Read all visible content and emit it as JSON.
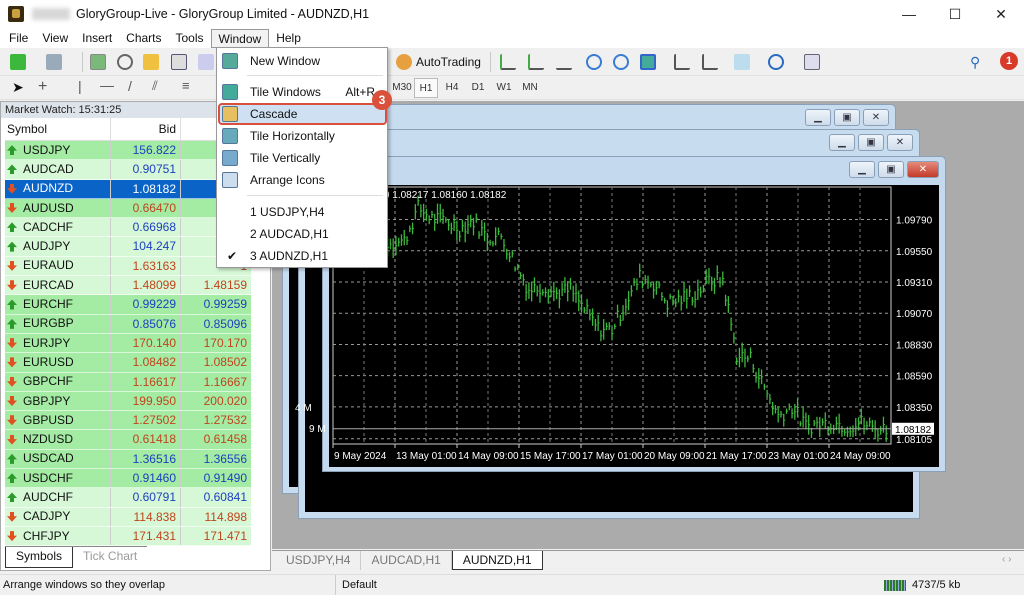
{
  "window": {
    "title": "GloryGroup-Live - GloryGroup Limited - AUDNZD,H1",
    "minimize": "—",
    "maximize": "☐",
    "close": "✕"
  },
  "menubar": [
    "File",
    "View",
    "Insert",
    "Charts",
    "Tools",
    "Window",
    "Help"
  ],
  "toolbar": {
    "autotrading": "AutoTrading",
    "timeframes": [
      "M30",
      "H1",
      "H4",
      "D1",
      "W1",
      "MN"
    ],
    "active_timeframe": "H1",
    "notification_count": "1"
  },
  "window_menu": {
    "items": [
      {
        "label": "New Window",
        "icon": "new-window-icon"
      },
      {
        "label": "Tile Windows",
        "shortcut": "Alt+R",
        "icon": "tile-windows-icon"
      },
      {
        "label": "Cascade",
        "icon": "cascade-icon",
        "highlighted": true
      },
      {
        "label": "Tile Horizontally",
        "icon": "tile-horizontally-icon"
      },
      {
        "label": "Tile Vertically",
        "icon": "tile-vertically-icon"
      },
      {
        "label": "Arrange Icons",
        "icon": "arrange-icons-icon"
      }
    ],
    "windows": [
      {
        "label": "1 USDJPY,H4"
      },
      {
        "label": "2 AUDCAD,H1"
      },
      {
        "label": "3 AUDNZD,H1",
        "checked": true
      }
    ],
    "check": "✔",
    "step_badge": "3"
  },
  "market_watch": {
    "title": "Market Watch: 15:31:25",
    "columns": [
      "Symbol",
      "Bid"
    ],
    "rows": [
      {
        "symbol": "USDJPY",
        "bid": "156.822",
        "ask": "1",
        "dir": "up",
        "shade": "g1"
      },
      {
        "symbol": "AUDCAD",
        "bid": "0.90751",
        "ask": "0",
        "dir": "up",
        "shade": "g0"
      },
      {
        "symbol": "AUDNZD",
        "bid": "1.08182",
        "ask": "1",
        "dir": "down",
        "shade": "sel"
      },
      {
        "symbol": "AUDUSD",
        "bid": "0.66470",
        "ask": "0",
        "dir": "down",
        "shade": "g1"
      },
      {
        "symbol": "CADCHF",
        "bid": "0.66968",
        "ask": "0",
        "dir": "up",
        "shade": "g0"
      },
      {
        "symbol": "AUDJPY",
        "bid": "104.247",
        "ask": "1",
        "dir": "up",
        "shade": "g0"
      },
      {
        "symbol": "EURAUD",
        "bid": "1.63163",
        "ask": "1",
        "dir": "down",
        "shade": "g0"
      },
      {
        "symbol": "EURCAD",
        "bid": "1.48099",
        "ask": "1.48159",
        "dir": "down",
        "shade": "g0"
      },
      {
        "symbol": "EURCHF",
        "bid": "0.99229",
        "ask": "0.99259",
        "dir": "up",
        "shade": "g1"
      },
      {
        "symbol": "EURGBP",
        "bid": "0.85076",
        "ask": "0.85096",
        "dir": "up",
        "shade": "g1"
      },
      {
        "symbol": "EURJPY",
        "bid": "170.140",
        "ask": "170.170",
        "dir": "down",
        "shade": "g1"
      },
      {
        "symbol": "EURUSD",
        "bid": "1.08482",
        "ask": "1.08502",
        "dir": "down",
        "shade": "g1"
      },
      {
        "symbol": "GBPCHF",
        "bid": "1.16617",
        "ask": "1.16667",
        "dir": "down",
        "shade": "g1"
      },
      {
        "symbol": "GBPJPY",
        "bid": "199.950",
        "ask": "200.020",
        "dir": "down",
        "shade": "g1"
      },
      {
        "symbol": "GBPUSD",
        "bid": "1.27502",
        "ask": "1.27532",
        "dir": "down",
        "shade": "g1"
      },
      {
        "symbol": "NZDUSD",
        "bid": "0.61418",
        "ask": "0.61458",
        "dir": "down",
        "shade": "g1"
      },
      {
        "symbol": "USDCAD",
        "bid": "1.36516",
        "ask": "1.36556",
        "dir": "up",
        "shade": "g1"
      },
      {
        "symbol": "USDCHF",
        "bid": "0.91460",
        "ask": "0.91490",
        "dir": "up",
        "shade": "g1"
      },
      {
        "symbol": "AUDCHF",
        "bid": "0.60791",
        "ask": "0.60841",
        "dir": "up",
        "shade": "g0"
      },
      {
        "symbol": "CADJPY",
        "bid": "114.838",
        "ask": "114.898",
        "dir": "down",
        "shade": "g0"
      },
      {
        "symbol": "CHFJPY",
        "bid": "171.431",
        "ask": "171.471",
        "dir": "down",
        "shade": "g0"
      }
    ],
    "tabs": [
      "Symbols",
      "Tick Chart"
    ]
  },
  "chart_windows": {
    "back1_axis_label": "4 M",
    "back2_axis_label": "9 M",
    "active_title": "ZD,H1",
    "ohlc_label": ",H1  1.08160 1.08217 1.08160 1.08182",
    "price_ticks": [
      "1.09790",
      "1.09550",
      "1.09310",
      "1.09070",
      "1.08830",
      "1.08590",
      "1.08350",
      "1.08105"
    ],
    "price_tick_values": [
      1.0979,
      1.0955,
      1.0931,
      1.0907,
      1.0883,
      1.0859,
      1.0835,
      1.08105
    ],
    "current_price": "1.08182",
    "current_price_value": 1.08182,
    "time_ticks": [
      "9 May 2024",
      "13 May 01:00",
      "14 May 09:00",
      "15 May 17:00",
      "17 May 01:00",
      "20 May 09:00",
      "21 May 17:00",
      "23 May 01:00",
      "24 May 09:00"
    ],
    "closes": [
      1.0958,
      1.0962,
      1.0955,
      1.096,
      1.0962,
      1.0962,
      1.0988,
      1.098,
      1.0978,
      1.0972,
      1.0978,
      1.0965,
      1.0966,
      1.0945,
      1.0925,
      1.0928,
      1.0922,
      1.0925,
      1.091,
      1.0895,
      1.0895,
      1.0915,
      1.0935,
      1.093,
      1.0915,
      1.0918,
      1.0922,
      1.0932,
      1.0933,
      1.0875,
      1.0872,
      1.085,
      1.0828,
      1.0835,
      1.082,
      1.0822,
      1.0823,
      1.082,
      1.0823,
      1.0818,
      1.0818
    ],
    "bar_color": "#3cb83c"
  },
  "doc_tabs": [
    "USDJPY,H4",
    "AUDCAD,H1",
    "AUDNZD,H1"
  ],
  "status": {
    "hint": "Arrange windows so they overlap",
    "profile": "Default",
    "traffic": "4737/5 kb"
  }
}
